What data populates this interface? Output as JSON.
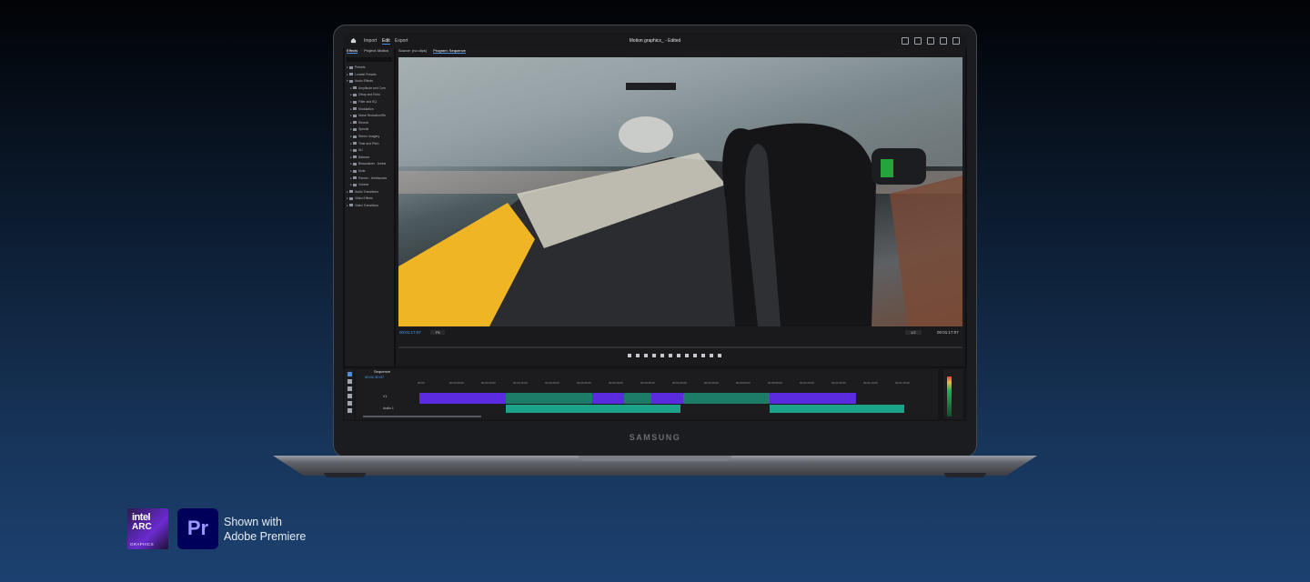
{
  "premiere": {
    "menu": {
      "items": [
        "Import",
        "Edit",
        "Export"
      ],
      "active": "Edit",
      "title": "Motion graphics_ - Edited"
    },
    "effects_panel": {
      "tabs": [
        "Effects",
        "Project: Motion"
      ],
      "tree": [
        {
          "label": "Presets",
          "level": 0
        },
        {
          "label": "Lumetri Presets",
          "level": 0
        },
        {
          "label": "Audio Effects",
          "level": 0,
          "open": true
        },
        {
          "label": "Amplitude and Com",
          "level": 1
        },
        {
          "label": "Delay and Echo",
          "level": 1
        },
        {
          "label": "Filter and EQ",
          "level": 1
        },
        {
          "label": "Modulation",
          "level": 1
        },
        {
          "label": "Noise Reduction/Re",
          "level": 1
        },
        {
          "label": "Reverb",
          "level": 1
        },
        {
          "label": "Special",
          "level": 1
        },
        {
          "label": "Stereo Imagery",
          "level": 1
        },
        {
          "label": "Time and Pitch",
          "level": 1
        },
        {
          "label": "AU",
          "level": 1
        },
        {
          "label": "Balance",
          "level": 1
        },
        {
          "label": "Binauralizer - Ambis",
          "level": 1
        },
        {
          "label": "Mute",
          "level": 1
        },
        {
          "label": "Panner - Ambisonics",
          "level": 1
        },
        {
          "label": "Volume",
          "level": 1
        },
        {
          "label": "Audio Transitions",
          "level": 0
        },
        {
          "label": "Video Effects",
          "level": 0
        },
        {
          "label": "Video Transitions",
          "level": 0
        }
      ]
    },
    "program": {
      "tabs": [
        "Source: (no clips)",
        "Program: Sequence"
      ],
      "timecode_left": "00:01:17:07",
      "fit": "Fit",
      "quality": "1/2",
      "timecode_right": "00:01:17:07"
    },
    "timeline": {
      "sequence_name": "Sequence",
      "timecode": "00:01:30:07",
      "ruler": [
        "00:00",
        "00:00:05:00",
        "00:00:10:00",
        "00:00:15:00",
        "00:00:20:00",
        "00:00:25:00",
        "00:00:30:00",
        "00:00:35:00",
        "00:00:40:00",
        "00:00:45:00",
        "00:00:50:00",
        "00:00:55:00",
        "00:01:00:00",
        "00:01:05:00",
        "00:01:10:00",
        "00:01:15:00"
      ],
      "video_track": "V1",
      "audio_track": "Audio 1"
    }
  },
  "laptop": {
    "brand": "SAMSUNG"
  },
  "badges": {
    "intel": {
      "line1": "intel",
      "line2": "ARC",
      "line3": "GRAPHICS"
    },
    "premiere": {
      "label": "Pr"
    }
  },
  "credit": {
    "line1": "Shown with",
    "line2": "Adobe Premiere"
  },
  "colors": {
    "accent": "#4a90e2",
    "video_clip": "#5b2be0",
    "green_clip": "#1d7c67",
    "audio_wave": "#1aa388",
    "premiere_bg": "#00005b"
  }
}
